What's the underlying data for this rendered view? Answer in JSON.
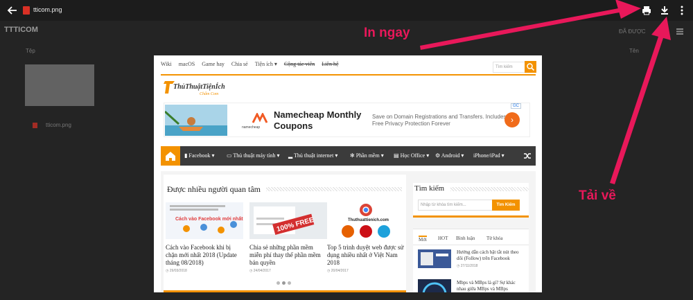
{
  "topbar": {
    "file_name": "tticom.png"
  },
  "background": {
    "title": "TTTICOM",
    "left_label": "Tệp",
    "right_label": "Tên",
    "file_name": "tticom.png",
    "corner_text": "ĐÃ ĐƯỢC"
  },
  "site": {
    "nav": [
      "Wiki",
      "macOS",
      "Game hay",
      "Chia sẻ",
      "Tiện ích",
      "Cộng tác viên",
      "Liên hệ"
    ],
    "search_placeholder": "Tìm kiếm",
    "logo_text": "ThủThuậtTiệnÍch",
    "logo_sub": "Chấm Com",
    "ad": {
      "brand": "namecheap",
      "title": "Namecheap Monthly Coupons",
      "desc": "Save on Domain Registrations and Transfers. Includes Free Privacy Protection Forever",
      "badge": "GC"
    },
    "main_nav": [
      "Facebook",
      "Thủ thuật máy tính",
      "Thủ thuật internet",
      "Phần mềm",
      "Học Office",
      "Android",
      "iPhone/iPad"
    ],
    "panel_title": "Được nhiều người quan tâm",
    "articles": [
      {
        "title": "Cách vào Facebook khi bị chặn mới nhất 2018 (Update tháng 08/2018)",
        "date": "29/03/2018",
        "thumb_text": "Cách vào Facebook mới nhất"
      },
      {
        "title": "Chia sẻ những phần mềm miễn phí thay thế phần mềm bản quyền",
        "date": "24/04/2017",
        "thumb_text": "100% FREE"
      },
      {
        "title": "Top 5 trình duyệt web được sử dụng nhiều nhất ở Việt Nam 2018",
        "date": "20/04/2017",
        "thumb_text": "Thuthuattienich.com"
      }
    ],
    "side_title": "Tìm kiếm",
    "side_placeholder": "Nhập từ khóa tìm kiếm...",
    "side_button": "Tìm Kiếm",
    "tabs": [
      "Mới",
      "HOT",
      "Bình luận",
      "Từ khóa"
    ],
    "tab_items": [
      {
        "title": "Hướng dẫn cách bật tắt nút theo dõi (Follow) trên Facebook",
        "date": "27/11/2018"
      },
      {
        "title": "Mbps và MBps là gì? Sự khác nhau giữa MBps và MBps",
        "date": ""
      }
    ]
  },
  "annotations": {
    "print": "In ngay",
    "download": "Tải về"
  },
  "colors": {
    "accent": "#f39200",
    "annotation": "#e8185a"
  }
}
